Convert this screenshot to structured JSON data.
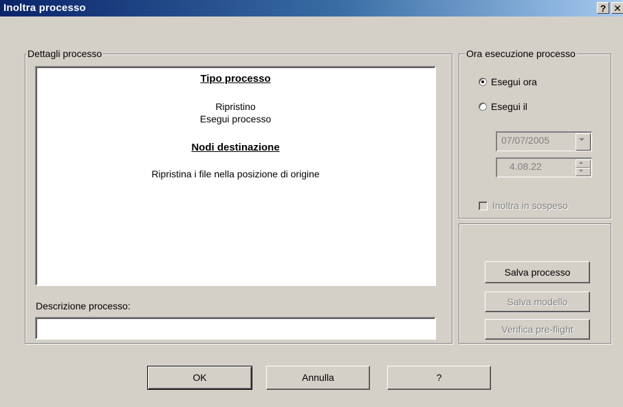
{
  "window": {
    "title": "Inoltra processo",
    "help_button": "?",
    "close_button": "✕"
  },
  "details_group": {
    "legend": "Dettagli processo",
    "heading_type": "Tipo processo",
    "type_line1": "Ripristino",
    "type_line2": "Esegui processo",
    "heading_nodes": "Nodi destinazione",
    "nodes_line": "Ripristina i file nella posizione di origine"
  },
  "description": {
    "label": "Descrizione processo:",
    "value": ""
  },
  "schedule_group": {
    "legend": "Ora esecuzione processo",
    "run_now_label": "Esegui ora",
    "run_now_selected": true,
    "run_at_label": "Esegui il",
    "run_at_selected": false,
    "date_value": "07/07/2005",
    "time_value": "4.08.22",
    "hold_label": "Inoltra in sospeso",
    "hold_checked": false
  },
  "actions": {
    "save_job": "Salva processo",
    "save_template": "Salva modello",
    "preflight": "Verifica pre-flight"
  },
  "footer": {
    "ok": "OK",
    "cancel": "Annulla",
    "help": "?"
  }
}
